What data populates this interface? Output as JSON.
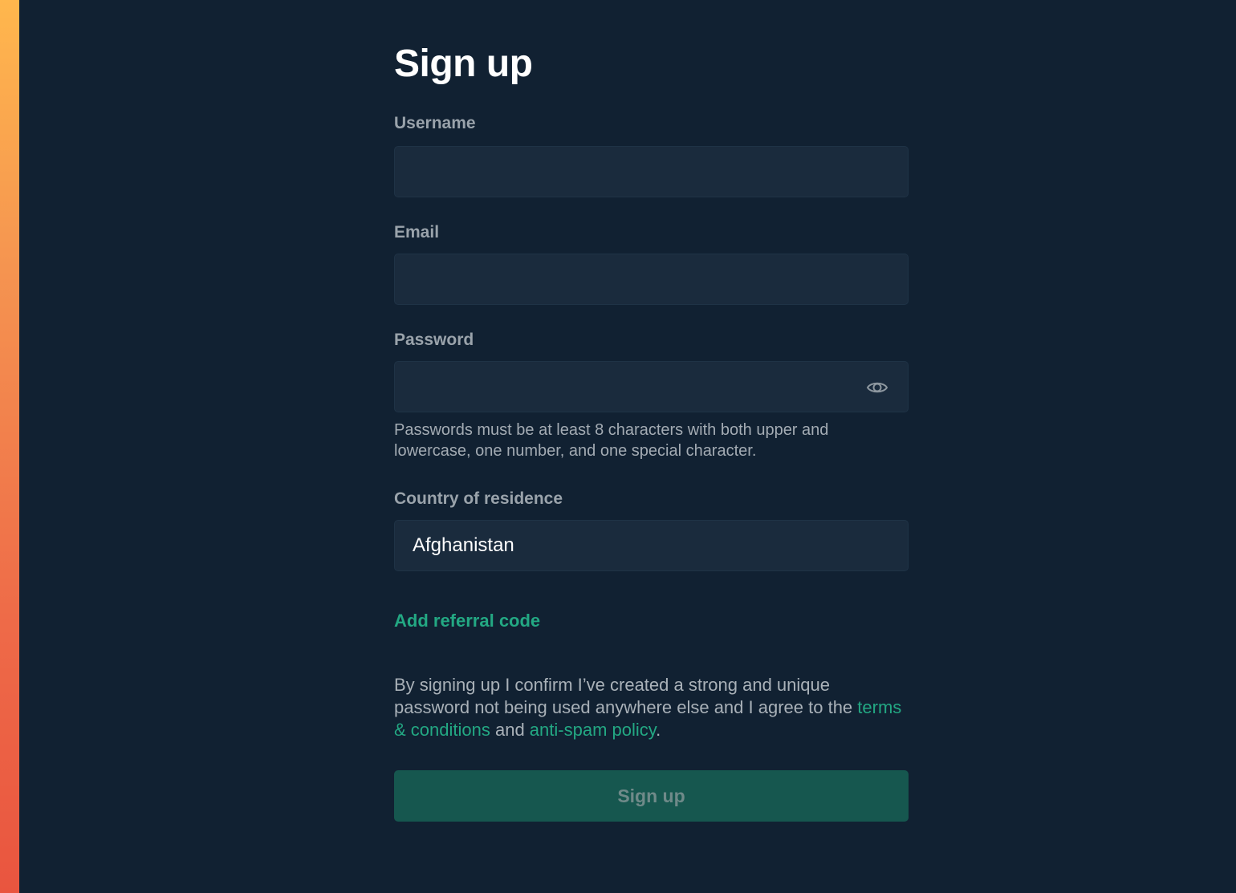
{
  "page": {
    "title": "Sign up"
  },
  "fields": {
    "username": {
      "label": "Username",
      "value": ""
    },
    "email": {
      "label": "Email",
      "value": ""
    },
    "password": {
      "label": "Password",
      "value": "",
      "hint": "Passwords must be at least 8 characters with both upper and lowercase, one number, and one special character.",
      "toggle_icon": "eye-icon"
    },
    "country": {
      "label": "Country of residence",
      "value": "Afghanistan"
    }
  },
  "referral": {
    "label": "Add referral code"
  },
  "consent": {
    "text_before": "By signing up I confirm I’ve created a strong and unique password not being used anywhere else and I agree to the ",
    "terms_link": "terms & conditions",
    "text_middle": " and ",
    "policy_link": "anti-spam policy",
    "text_after": "."
  },
  "submit": {
    "label": "Sign up"
  },
  "colors": {
    "background": "#112132",
    "input_background": "#1a2b3d",
    "accent": "#23a883",
    "button_background": "#16574f",
    "sidebar_gradient_top": "#ffb74d",
    "sidebar_gradient_bottom": "#e9553f"
  }
}
